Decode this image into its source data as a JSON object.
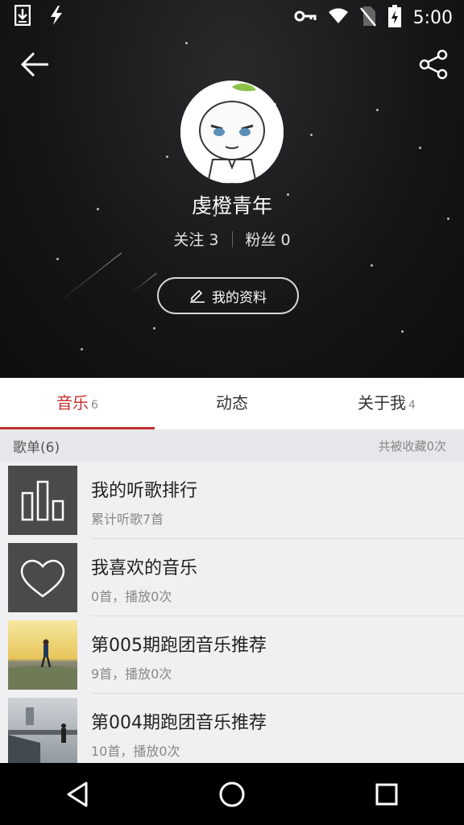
{
  "status_bar": {
    "time": "5:00"
  },
  "profile": {
    "name": "虔橙青年",
    "follow_label": "关注 3",
    "fans_label": "粉丝 0",
    "edit_button": "我的资料"
  },
  "tabs": [
    {
      "label": "音乐",
      "count": "6",
      "active": true
    },
    {
      "label": "动态",
      "count": ""
    },
    {
      "label": "关于我",
      "count": "4"
    }
  ],
  "section": {
    "title": "歌单(6)",
    "meta": "共被收藏0次"
  },
  "playlists": [
    {
      "title": "我的听歌排行",
      "subtitle": "累计听歌7首",
      "icon": "bar-chart-icon"
    },
    {
      "title": "我喜欢的音乐",
      "subtitle": "0首，播放0次",
      "icon": "heart-icon"
    },
    {
      "title": "第005期跑团音乐推荐",
      "subtitle": "9首，播放0次",
      "icon": "runner-photo"
    },
    {
      "title": "第004期跑团音乐推荐",
      "subtitle": "10首，播放0次",
      "icon": "runner-photo"
    }
  ],
  "colors": {
    "accent": "#c62f2f",
    "hero_bg": "#151517"
  }
}
